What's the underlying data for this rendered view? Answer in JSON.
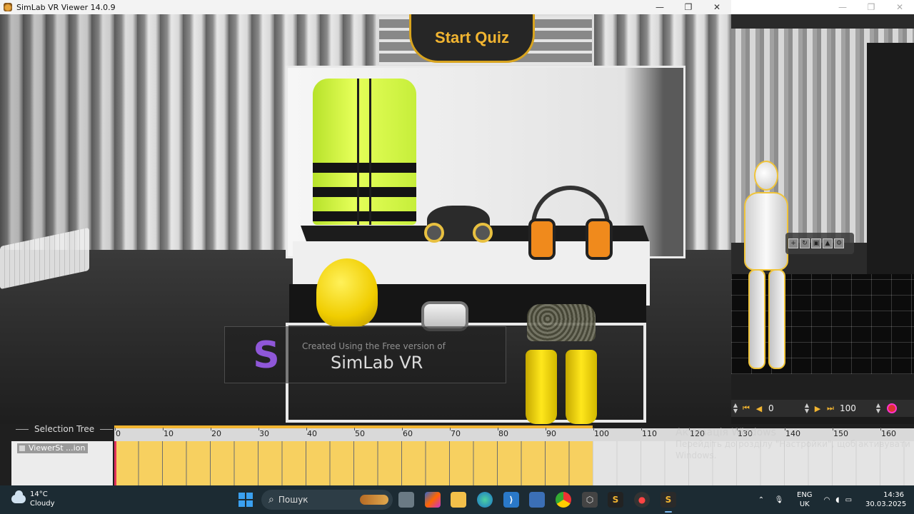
{
  "window": {
    "title": "SimLab VR Viewer 14.0.9",
    "minimize": "—",
    "maximize": "❐",
    "close": "✕"
  },
  "viewport": {
    "start_quiz_label": "Start Quiz",
    "watermark_small": "Created Using the Free version of",
    "watermark_big": "SimLab VR",
    "watermark_logo": "S"
  },
  "playback": {
    "first": "⏮",
    "prev": "◀",
    "start_frame": "0",
    "next": "▶",
    "last": "⏭",
    "end_frame": "100"
  },
  "timeline": {
    "selection_tree_label": "Selection Tree",
    "tracks": [
      {
        "label": "ViewerSt ...ion"
      }
    ],
    "ruler_ticks": [
      "0",
      "10",
      "20",
      "30",
      "40",
      "50",
      "60",
      "70",
      "80",
      "90",
      "100",
      "110",
      "120",
      "130",
      "140",
      "150",
      "160"
    ],
    "playhead_frame": 0,
    "range_end_frame": 100,
    "activate_windows": {
      "title": "Активація Windows",
      "line1": "Перейдіть до розділу \"Настройки\", щоб активувати",
      "line2": "Windows."
    }
  },
  "taskbar": {
    "weather_temp": "14°C",
    "weather_desc": "Cloudy",
    "search_placeholder": "Пошук",
    "lang": "ENG",
    "lang_region": "UK",
    "time": "14:36",
    "date": "30.03.2025"
  },
  "colors": {
    "accent_yellow": "#f2b531",
    "timeline_fill": "#f7d060",
    "playhead": "#e0305a",
    "taskbar_bg": "#1c2b33"
  }
}
